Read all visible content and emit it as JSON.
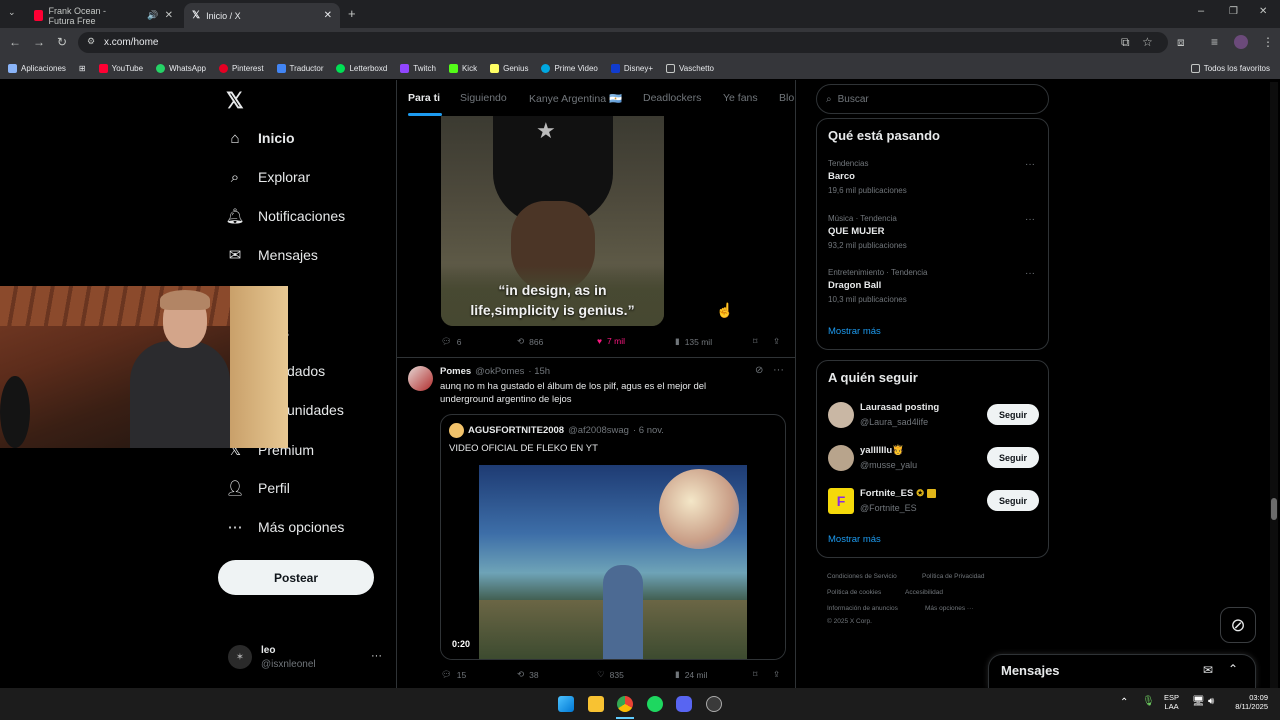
{
  "browser": {
    "tabs": [
      {
        "title": "Frank Ocean - Futura Free",
        "favicon_color": "#ff0033"
      },
      {
        "title": "Inicio / X",
        "favicon_color": "#ffffff"
      }
    ],
    "url": "x.com/home",
    "bookmarks": [
      {
        "label": "Aplicaciones",
        "color": "#8ab4f8"
      },
      {
        "label": "YouTube",
        "color": "#ff0033"
      },
      {
        "label": "WhatsApp",
        "color": "#25d366"
      },
      {
        "label": "Pinterest",
        "color": "#e60023"
      },
      {
        "label": "Traductor",
        "color": "#4285f4"
      },
      {
        "label": "Letterboxd",
        "color": "#00e054"
      },
      {
        "label": "Twitch",
        "color": "#9146ff"
      },
      {
        "label": "Kick",
        "color": "#53fc18"
      },
      {
        "label": "Genius",
        "color": "#ffff64"
      },
      {
        "label": "Prime Video",
        "color": "#00a8e1"
      },
      {
        "label": "Disney+",
        "color": "#113ccf"
      },
      {
        "label": "Vaschetto",
        "color": "#c4c7c5"
      }
    ],
    "all_bookmarks": "Todos los favoritos"
  },
  "sidebar": {
    "items": [
      {
        "label": "Inicio",
        "icon": "home-icon"
      },
      {
        "label": "Explorar",
        "icon": "search-icon"
      },
      {
        "label": "Notificaciones",
        "icon": "bell-icon"
      },
      {
        "label": "Mensajes",
        "icon": "mail-icon"
      },
      {
        "label": "s",
        "icon": ""
      },
      {
        "label": "dados",
        "icon": ""
      },
      {
        "label": "unidades",
        "icon": ""
      },
      {
        "label": "Premium",
        "icon": "x-icon"
      },
      {
        "label": "Perfil",
        "icon": "person-icon"
      },
      {
        "label": "Más opciones",
        "icon": "more-circle-icon"
      }
    ],
    "post_button": "Postear",
    "account": {
      "name": "leo",
      "handle": "@isxnleonel"
    }
  },
  "timeline": {
    "tabs": [
      "Para ti",
      "Siguiendo",
      "Kanye Argentina 🇦🇷",
      "Deadlockers",
      "Ye fans",
      "Blo"
    ],
    "tweet1": {
      "caption_line1": "“in design, as in",
      "caption_line2": "life,simplicity is genius.”",
      "replies": "6",
      "reposts": "866",
      "likes": "7 mil",
      "views": "135 mil"
    },
    "tweet2": {
      "name": "Pomes",
      "handle": "@okPomes",
      "time": "· 15h",
      "text": "aunq no m ha gustado el álbum de los pilf, agus es el mejor del underground argentino de lejos",
      "quote": {
        "name": "AGUSFORTNITE2008",
        "handle": "@af2008swag",
        "time": "· 6 nov.",
        "text": "VIDEO OFICIAL DE FLEKO EN YT",
        "duration": "0:20"
      },
      "replies": "15",
      "reposts": "38",
      "likes": "835",
      "views": "24 mil"
    }
  },
  "right": {
    "search_placeholder": "Buscar",
    "trending_title": "Qué está pasando",
    "trends": [
      {
        "category": "Tendencias",
        "name": "Barco",
        "count": "19,6 mil publicaciones"
      },
      {
        "category": "Música · Tendencia",
        "name": "QUE MUJER",
        "count": "93,2 mil publicaciones"
      },
      {
        "category": "Entretenimiento · Tendencia",
        "name": "Dragon Ball",
        "count": "10,3 mil publicaciones"
      }
    ],
    "show_more": "Mostrar más",
    "follow_title": "A quién seguir",
    "follows": [
      {
        "name": "Laurasad posting",
        "handle": "@Laura_sad4life",
        "color": "#c9b7a4"
      },
      {
        "name": "yallllllu🫅",
        "handle": "@musse_yalu",
        "color": "#b8a48c"
      },
      {
        "name": "Fortnite_ES",
        "handle": "@Fortnite_ES",
        "color": "#f5d90a"
      }
    ],
    "follow_label": "Seguir",
    "footer": [
      "Condiciones de Servicio",
      "Política de Privacidad",
      "Política de cookies",
      "Accesibilidad",
      "Información de anuncios",
      "Más opciones ···",
      "© 2025 X Corp."
    ],
    "messages": "Mensajes"
  },
  "taskbar": {
    "lang1": "ESP",
    "lang2": "LAA",
    "time": "03:09",
    "date": "8/11/2025"
  }
}
